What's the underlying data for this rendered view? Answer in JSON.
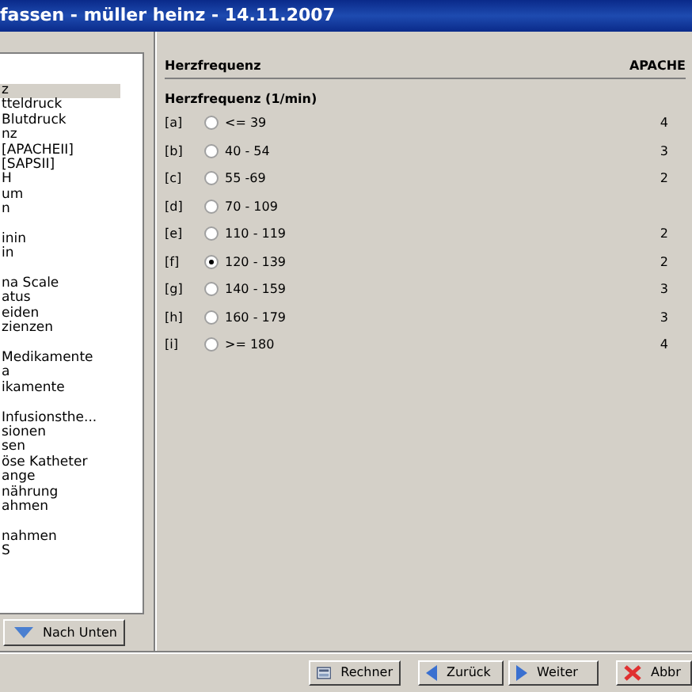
{
  "window": {
    "title": "fassen - müller heinz - 14.11.2007"
  },
  "navigation": {
    "groups": [
      {
        "items": [
          {
            "label": "z",
            "selected": true
          },
          {
            "label": "tteldruck",
            "selected": false
          },
          {
            "label": "Blutdruck",
            "selected": false
          },
          {
            "label": "nz",
            "selected": false
          },
          {
            "label": "[APACHEII]",
            "selected": false
          },
          {
            "label": "[SAPSII]",
            "selected": false
          },
          {
            "label": "H",
            "selected": false
          },
          {
            "label": "um",
            "selected": false
          },
          {
            "label": "n",
            "selected": false
          }
        ]
      },
      {
        "items": [
          {
            "label": "inin",
            "selected": false
          },
          {
            "label": "in",
            "selected": false
          }
        ]
      },
      {
        "items": [
          {
            "label": "na Scale",
            "selected": false
          },
          {
            "label": "atus",
            "selected": false
          },
          {
            "label": "eiden",
            "selected": false
          },
          {
            "label": "zienzen",
            "selected": false
          }
        ]
      },
      {
        "items": [
          {
            "label": "Medikamente",
            "selected": false
          },
          {
            "label": "a",
            "selected": false
          },
          {
            "label": "ikamente",
            "selected": false
          }
        ]
      },
      {
        "items": [
          {
            "label": "Infusionsthe...",
            "selected": false
          },
          {
            "label": "sionen",
            "selected": false
          },
          {
            "label": "sen",
            "selected": false
          },
          {
            "label": "öse Katheter",
            "selected": false
          },
          {
            "label": "ange",
            "selected": false
          },
          {
            "label": "nährung",
            "selected": false
          },
          {
            "label": "ahmen",
            "selected": false
          }
        ]
      },
      {
        "items": [
          {
            "label": "nahmen",
            "selected": false
          },
          {
            "label": "S",
            "selected": false
          }
        ]
      }
    ],
    "down_button": "Nach Unten"
  },
  "question": {
    "title": "Herzfrequenz",
    "score_column": "APACHE",
    "subtitle": "Herzfrequenz (1/min)",
    "options": [
      {
        "key": "[a]",
        "label": "<= 39",
        "score": "4",
        "selected": false
      },
      {
        "key": "[b]",
        "label": "40 - 54",
        "score": "3",
        "selected": false
      },
      {
        "key": "[c]",
        "label": "55 -69",
        "score": "2",
        "selected": false
      },
      {
        "key": "[d]",
        "label": "70 - 109",
        "selected": false
      },
      {
        "key": "[e]",
        "label": "110 - 119",
        "score": "2",
        "selected": false
      },
      {
        "key": "[f]",
        "label": "120 - 139",
        "score": "2",
        "selected": true
      },
      {
        "key": "[g]",
        "label": "140 - 159",
        "score": "3",
        "selected": false
      },
      {
        "key": "[h]",
        "label": "160 - 179",
        "score": "3",
        "selected": false
      },
      {
        "key": "[i]",
        "label": ">= 180",
        "score": "4",
        "selected": false
      }
    ]
  },
  "footer": {
    "buttons": [
      {
        "kind": "calculator",
        "label": "Rechner"
      },
      {
        "kind": "back",
        "label": "Zurück"
      },
      {
        "kind": "next",
        "label": "Weiter"
      },
      {
        "kind": "cancel",
        "label": "Abbr"
      }
    ]
  }
}
